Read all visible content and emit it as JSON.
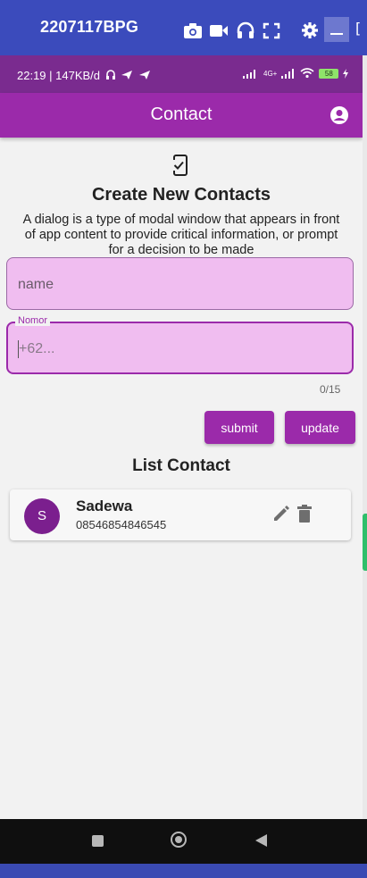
{
  "emulator": {
    "title": "2207117BPG",
    "edge_glyph": "["
  },
  "status_bar": {
    "left_text": "22:19 | 147KB/d",
    "network": "4G+",
    "battery": "58"
  },
  "app_bar": {
    "title": "Contact"
  },
  "form": {
    "heading": "Create New Contacts",
    "description": "A dialog is a type of modal window that appears in front of app content to provide critical information, or prompt for a decision to be made",
    "name_placeholder": "name",
    "nomor_label": "Nomor",
    "nomor_placeholder": "+62...",
    "counter": "0/15",
    "submit_label": "submit",
    "update_label": "update"
  },
  "list": {
    "title": "List Contact",
    "contacts": [
      {
        "initial": "S",
        "name": "Sadewa",
        "number": "08546854846545"
      }
    ]
  },
  "colors": {
    "primary": "#9b2aaa",
    "status_bar": "#7a2b8f",
    "field_fill": "#f0bdf0",
    "emulator_bar": "#3b4bbc"
  },
  "icons": [
    "camera-icon",
    "video-icon",
    "headset-icon",
    "fullscreen-icon",
    "gear-icon",
    "minimize-icon",
    "account-icon",
    "phone-check-icon",
    "edit-icon",
    "delete-icon"
  ]
}
